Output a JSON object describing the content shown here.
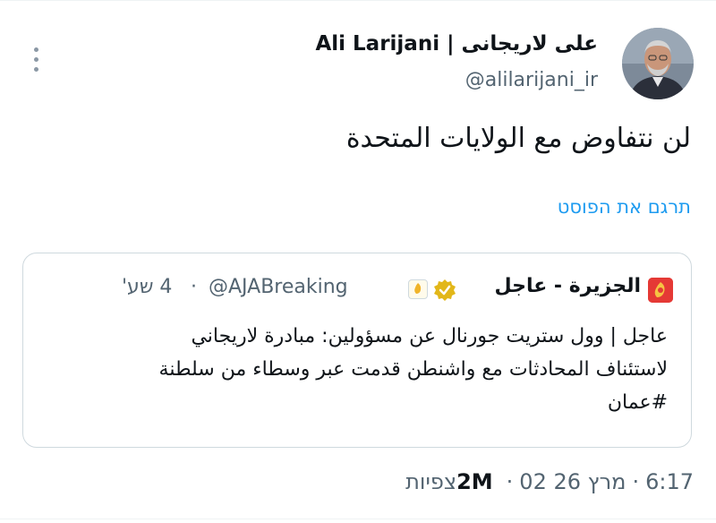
{
  "author": {
    "name": "Ali Larijani | علی لاریجانی",
    "handle": "@alilarijani_ir",
    "avatar_icon": "person-avatar"
  },
  "tweet": {
    "text": "لن نتفاوض مع الولايات المتحدة",
    "translate_label": "תרגם את הפוסט"
  },
  "quote": {
    "name": "الجزيرة - عاجل",
    "handle": "@AJABreaking",
    "time": "4 שע'",
    "lines": [
      "عاجل | وول ستريت جورنال عن مسؤولين: مبادرة لاريجاني",
      "لاستئناف المحادثات مع واشنطن قدمت عبر وسطاء من سلطنة",
      "#عمان"
    ]
  },
  "meta": {
    "time": "6:17",
    "date": "02 מרץ 26",
    "views_count": "2M",
    "views_label": "צפיות"
  },
  "colors": {
    "link": "#1d9bf0",
    "verified": "#e2b719",
    "aljazeera_red": "#e53935"
  }
}
